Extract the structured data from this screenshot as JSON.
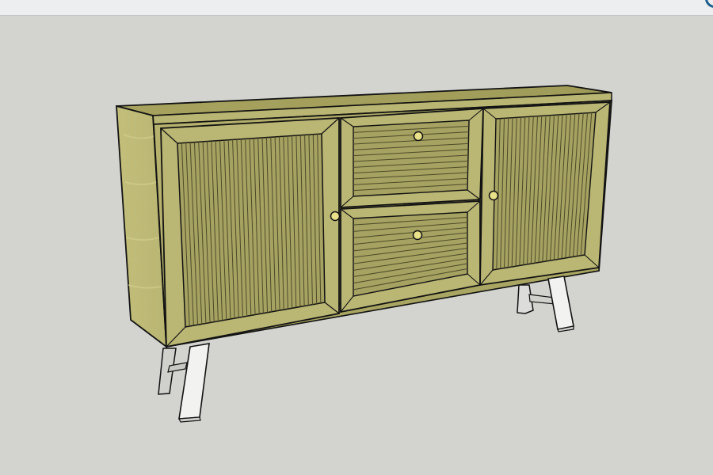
{
  "window": {
    "top_bar": "",
    "corner_icon": "navigation-badge-icon"
  },
  "viewport": {
    "background_color": "#d3d4d0",
    "model": {
      "name": "",
      "components": [
        "cabinet-top",
        "cabinet-front",
        "cabinet-side",
        "left-door",
        "upper-drawer",
        "lower-drawer",
        "right-door",
        "left-door-knob",
        "upper-drawer-knob",
        "lower-drawer-knob",
        "right-door-knob",
        "front-left-leg",
        "rear-left-leg",
        "front-right-leg",
        "rear-right-leg"
      ],
      "colors": {
        "wood": "#b4b16b",
        "wood_light": "#c4c07e",
        "wood_dark": "#8f8c4f",
        "fluting": "#5a5630",
        "legs": "#f2f2f0",
        "legs_shadow": "#cfd0cc",
        "knob": "#e9e08a",
        "outline": "#121212"
      }
    }
  }
}
